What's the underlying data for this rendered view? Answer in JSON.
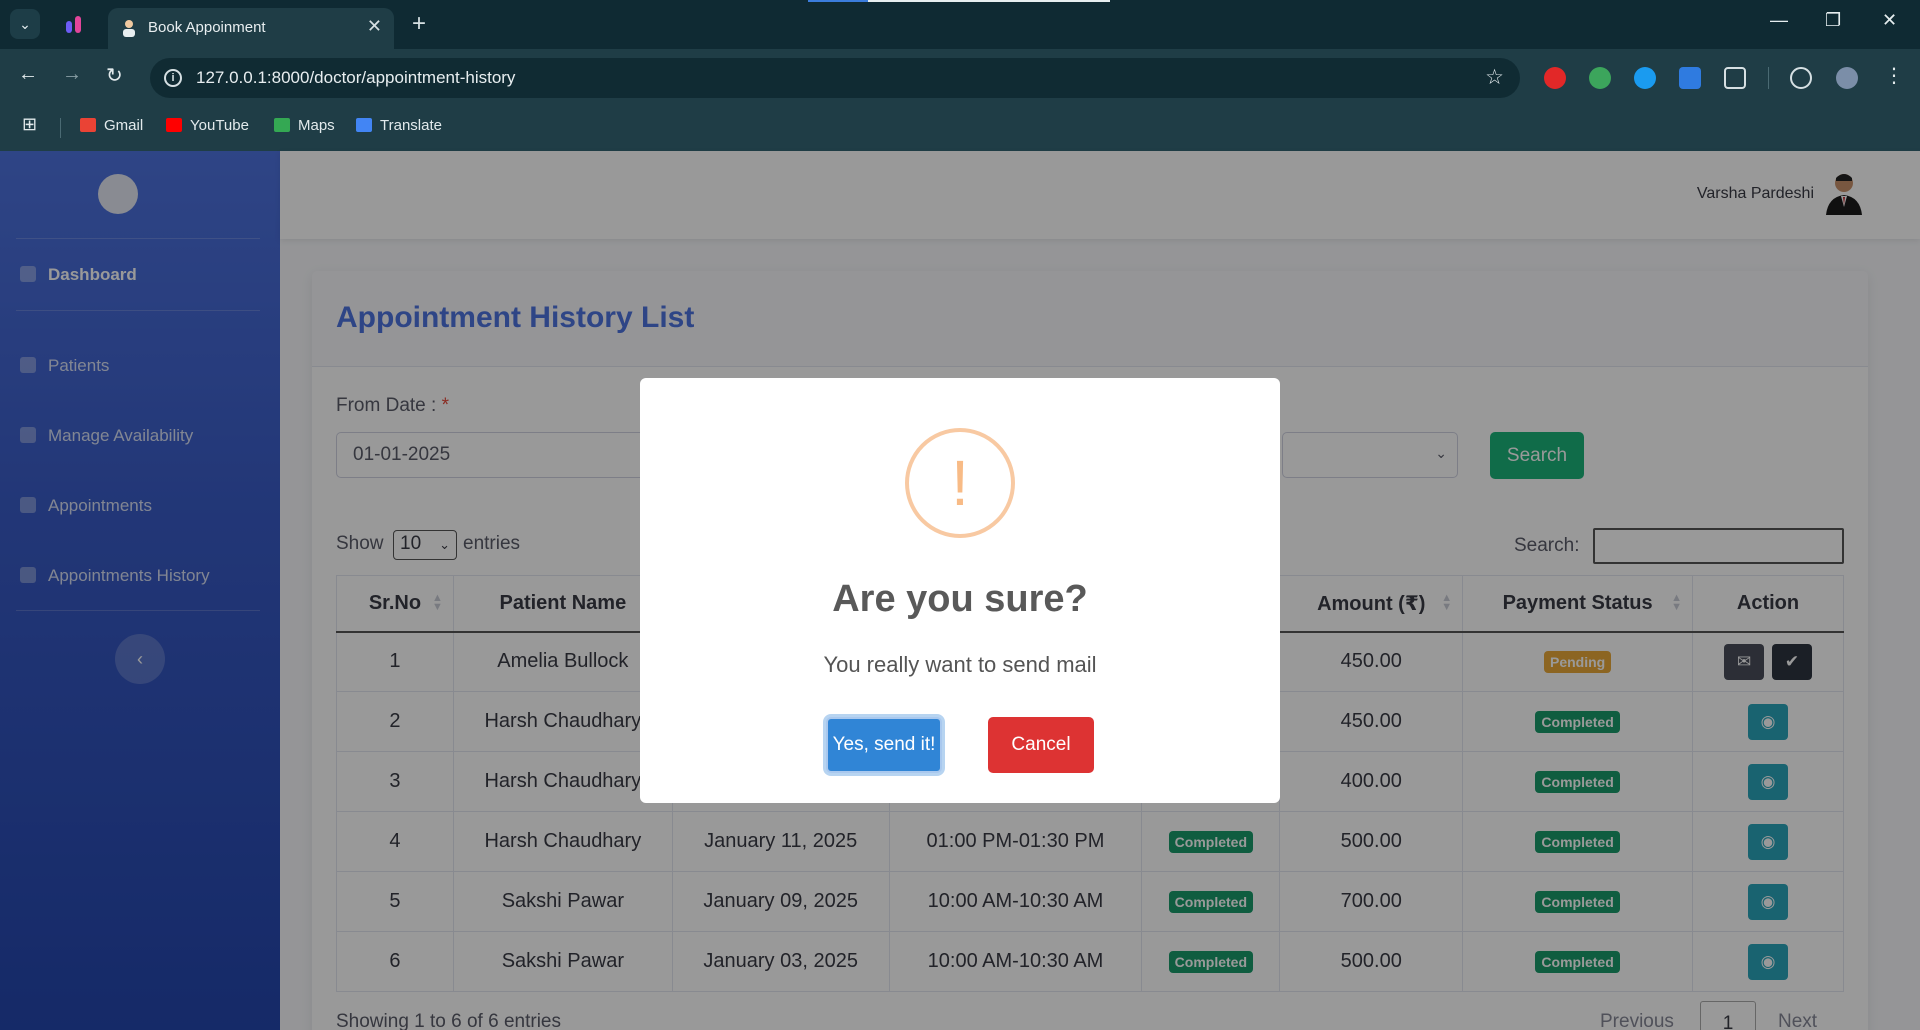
{
  "browser": {
    "tab_title": "Book Appoinment",
    "url": "127.0.0.1:8000/doctor/appointment-history",
    "bookmarks": [
      "Gmail",
      "YouTube",
      "Maps",
      "Translate"
    ],
    "new_tab_glyph": "+",
    "close_glyph": "✕"
  },
  "sidebar": {
    "items": [
      {
        "label": "Dashboard",
        "icon": "tachometer-icon"
      },
      {
        "label": "Patients",
        "icon": "user-icon"
      },
      {
        "label": "Manage Availability",
        "icon": "calendar-icon"
      },
      {
        "label": "Appointments",
        "icon": "calendar-icon"
      },
      {
        "label": "Appointments History",
        "icon": "calendar-icon"
      }
    ],
    "toggle_glyph": "‹"
  },
  "topbar": {
    "user_name": "Varsha Pardeshi"
  },
  "card": {
    "title": "Appointment History List",
    "from_date_label": "From Date :",
    "required_mark": "*",
    "from_date_value": "01-01-2025",
    "search_button": "Search",
    "show_label": "Show",
    "entries_label": "entries",
    "page_length": "10",
    "search_label": "Search:",
    "columns": [
      "Sr.No",
      "Patient Name",
      "",
      "",
      "",
      "Amount (₹)",
      "Payment Status",
      "Action"
    ],
    "rows": [
      {
        "sr": "1",
        "patient": "Amelia Bullock",
        "date": "",
        "time": "",
        "status": "",
        "amount": "450.00",
        "payment": "Pending"
      },
      {
        "sr": "2",
        "patient": "Harsh Chaudhary",
        "date": "",
        "time": "",
        "status": "",
        "amount": "450.00",
        "payment": "Completed"
      },
      {
        "sr": "3",
        "patient": "Harsh Chaudhary",
        "date": "",
        "time": "",
        "status": "",
        "amount": "400.00",
        "payment": "Completed"
      },
      {
        "sr": "4",
        "patient": "Harsh Chaudhary",
        "date": "January 11, 2025",
        "time": "01:00 PM-01:30 PM",
        "status": "Completed",
        "amount": "500.00",
        "payment": "Completed"
      },
      {
        "sr": "5",
        "patient": "Sakshi Pawar",
        "date": "January 09, 2025",
        "time": "10:00 AM-10:30 AM",
        "status": "Completed",
        "amount": "700.00",
        "payment": "Completed"
      },
      {
        "sr": "6",
        "patient": "Sakshi Pawar",
        "date": "January 03, 2025",
        "time": "10:00 AM-10:30 AM",
        "status": "Completed",
        "amount": "500.00",
        "payment": "Completed"
      }
    ],
    "footer_info": "Showing 1 to 6 of 6 entries",
    "pager": {
      "previous": "Previous",
      "current": "1",
      "next": "Next"
    }
  },
  "modal": {
    "icon_glyph": "!",
    "title": "Are you sure?",
    "text": "You really want to send mail",
    "confirm": "Yes, send it!",
    "cancel": "Cancel"
  },
  "icons": {
    "view": "eye-icon",
    "mail": "envelope-icon",
    "check": "check-icon"
  },
  "colors": {
    "primary": "#4e73df",
    "success": "#1cb47a",
    "warning": "#e9a93a",
    "info": "#2aa6bb",
    "danger": "#dd3333",
    "confirm": "#3085d6"
  }
}
